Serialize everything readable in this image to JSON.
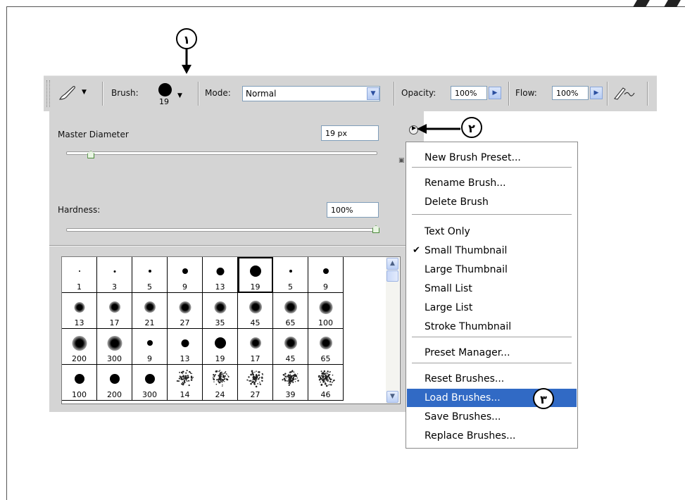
{
  "options_bar": {
    "brush_label": "Brush:",
    "brush_size": "19",
    "mode_label": "Mode:",
    "mode_value": "Normal",
    "opacity_label": "Opacity:",
    "opacity_value": "100%",
    "flow_label": "Flow:",
    "flow_value": "100%",
    "tool_icon": "brush-icon",
    "airbrush_icon": "airbrush-icon"
  },
  "brush_panel": {
    "master_diameter_label": "Master Diameter",
    "master_diameter_value": "19 px",
    "master_diameter_level": 0.08,
    "hardness_label": "Hardness:",
    "hardness_value": "100%",
    "hardness_level": 1.0,
    "presets": [
      [
        "1",
        "3",
        "5",
        "9",
        "13",
        "19",
        "5",
        "9"
      ],
      [
        "13",
        "17",
        "21",
        "27",
        "35",
        "45",
        "65",
        "100"
      ],
      [
        "200",
        "300",
        "9",
        "13",
        "19",
        "17",
        "45",
        "65"
      ],
      [
        "100",
        "200",
        "300",
        "14",
        "24",
        "27",
        "39",
        "46"
      ]
    ],
    "selected_preset": "19"
  },
  "menu": {
    "items": [
      {
        "label": "New Brush Preset...",
        "selected": false,
        "checked": false
      },
      {
        "label": "Rename Brush...",
        "selected": false,
        "checked": false
      },
      {
        "label": "Delete Brush",
        "selected": false,
        "checked": false
      },
      {
        "label": "Text Only",
        "selected": false,
        "checked": false
      },
      {
        "label": "Small Thumbnail",
        "selected": false,
        "checked": true
      },
      {
        "label": "Large Thumbnail",
        "selected": false,
        "checked": false
      },
      {
        "label": "Small List",
        "selected": false,
        "checked": false
      },
      {
        "label": "Large List",
        "selected": false,
        "checked": false
      },
      {
        "label": "Stroke Thumbnail",
        "selected": false,
        "checked": false
      },
      {
        "label": "Preset Manager...",
        "selected": false,
        "checked": false
      },
      {
        "label": "Reset Brushes...",
        "selected": false,
        "checked": false
      },
      {
        "label": "Load Brushes...",
        "selected": true,
        "checked": false
      },
      {
        "label": "Save Brushes...",
        "selected": false,
        "checked": false
      },
      {
        "label": "Replace Brushes...",
        "selected": false,
        "checked": false
      }
    ],
    "check_mark": "✔"
  },
  "callouts": [
    "١",
    "٢",
    "٣"
  ],
  "colors": {
    "menu_highlight": "#316ac5",
    "panel_bg": "#d4d4d4"
  }
}
